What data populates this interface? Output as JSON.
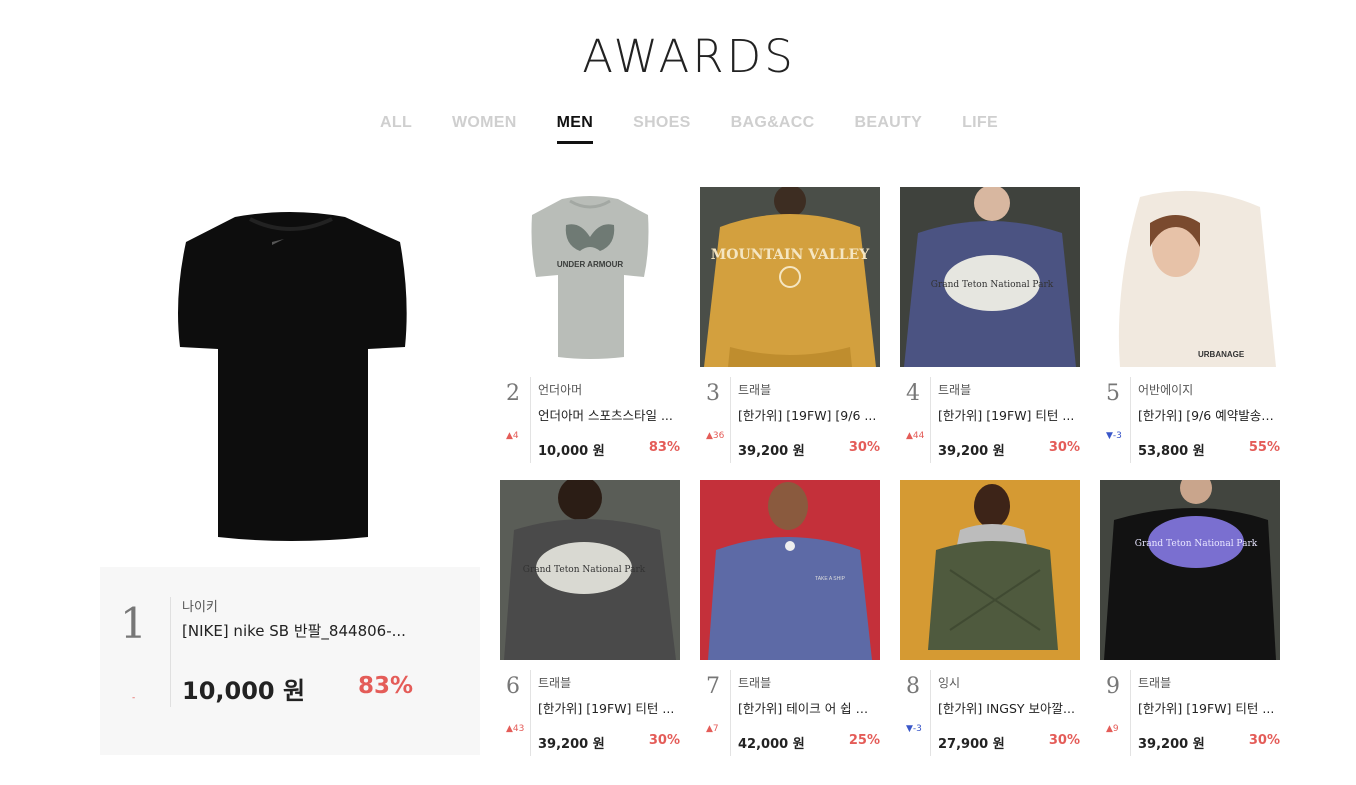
{
  "header": {
    "title": "AWARDS"
  },
  "tabs": [
    {
      "label": "ALL",
      "active": false
    },
    {
      "label": "WOMEN",
      "active": false
    },
    {
      "label": "MEN",
      "active": true
    },
    {
      "label": "SHOES",
      "active": false
    },
    {
      "label": "BAG&ACC",
      "active": false
    },
    {
      "label": "BEAUTY",
      "active": false
    },
    {
      "label": "LIFE",
      "active": false
    }
  ],
  "featured": {
    "rank": "1",
    "change": "-",
    "brand": "나이키",
    "name": "[NIKE] nike SB 반팔_844806-...",
    "price": "10,000 원",
    "discount": "83%"
  },
  "products": [
    {
      "rank": "2",
      "change": "▲4",
      "dir": "up",
      "brand": "언더아머",
      "name": "언더아머 스포츠스타일 ...",
      "price": "10,000 원",
      "discount": "83%"
    },
    {
      "rank": "3",
      "change": "▲36",
      "dir": "up",
      "brand": "트래블",
      "name": "[한가위] [19FW] [9/6 ...",
      "price": "39,200 원",
      "discount": "30%"
    },
    {
      "rank": "4",
      "change": "▲44",
      "dir": "up",
      "brand": "트래블",
      "name": "[한가위] [19FW] 티턴 ...",
      "price": "39,200 원",
      "discount": "30%"
    },
    {
      "rank": "5",
      "change": "▼-3",
      "dir": "down",
      "brand": "어반에이지",
      "name": "[한가위] [9/6 예약발송] ...",
      "price": "53,800 원",
      "discount": "55%"
    },
    {
      "rank": "6",
      "change": "▲43",
      "dir": "up",
      "brand": "트래블",
      "name": "[한가위] [19FW] 티턴 ...",
      "price": "39,200 원",
      "discount": "30%"
    },
    {
      "rank": "7",
      "change": "▲7",
      "dir": "up",
      "brand": "트래블",
      "name": "[한가위] 테이크 어 쉽 피...",
      "price": "42,000 원",
      "discount": "25%"
    },
    {
      "rank": "8",
      "change": "▼-3",
      "dir": "down",
      "brand": "잉시",
      "name": "[한가위] INGSY 보아깔...",
      "price": "27,900 원",
      "discount": "30%"
    },
    {
      "rank": "9",
      "change": "▲9",
      "dir": "up",
      "brand": "트래블",
      "name": "[한가위] [19FW] 티턴 ...",
      "price": "39,200 원",
      "discount": "30%"
    }
  ],
  "image_text": {
    "ua_logo": "UNDER ARMOUR",
    "mountain_valley": "MOUNTAIN VALLEY",
    "grand_teton": "Grand Teton National Park",
    "urbanage": "URBANAGE",
    "take_a_ship": "TAKE A SHIP"
  },
  "colors": {
    "accent_red": "#e45c58",
    "down_blue": "#3a57c9",
    "tab_inactive": "#cfcfcf"
  }
}
